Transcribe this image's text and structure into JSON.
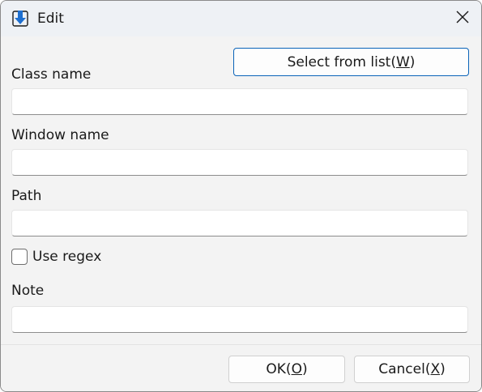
{
  "window": {
    "title": "Edit",
    "icon": "download-arrow-icon",
    "close_label": "✕"
  },
  "form": {
    "select_button": {
      "text": "Select from list(",
      "mnemonic": "W",
      "suffix": ")"
    },
    "class_name_label": "Class name",
    "class_name_value": "",
    "window_name_label": "Window name",
    "window_name_value": "",
    "path_label": "Path",
    "path_value": "",
    "use_regex_label": "Use regex",
    "use_regex_checked": false,
    "note_label": "Note",
    "note_value": ""
  },
  "footer": {
    "ok": {
      "text": "OK(",
      "mnemonic": "O",
      "suffix": ")"
    },
    "cancel": {
      "text": "Cancel(",
      "mnemonic": "X",
      "suffix": ")"
    }
  },
  "colors": {
    "accent": "#0a63b8",
    "titlebar": "#eef1f5",
    "background": "#f3f3f3"
  }
}
